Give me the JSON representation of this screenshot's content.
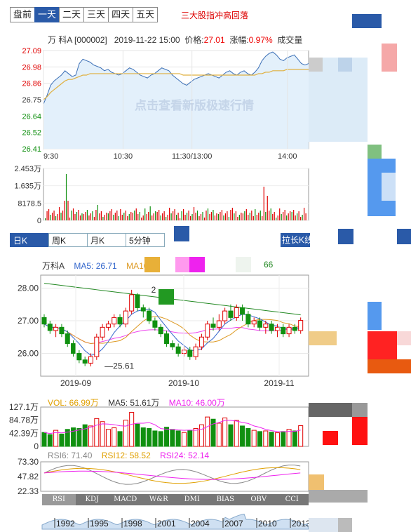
{
  "tabs": [
    "盘前",
    "一天",
    "二天",
    "三天",
    "四天",
    "五天"
  ],
  "active_tab": 1,
  "news": "三大股指冲高回落",
  "info": {
    "name": "万 科A [000002]",
    "datetime": "2019-11-22 15:00",
    "price_label": "价格:",
    "price": "27.01",
    "change_label": "涨幅:",
    "change": "0.97%",
    "volume_label": "成交量"
  },
  "watermark": "点击查看新版极速行情",
  "kline_tabs": [
    "日K",
    "周K",
    "月K",
    "5分钟"
  ],
  "kline_button": "拉长K线",
  "kline_legend": {
    "name": "万科A",
    "ma5": "MA5: 26.71",
    "ma10": "MA10",
    "extra": "66"
  },
  "vol_legend": {
    "vol": "VOL: 66.99万",
    "ma5": "MA5: 51.61万",
    "ma10": "MA10: 46.00万"
  },
  "rsi_legend": {
    "rsi6": "RSI6: 71.40",
    "rsi12": "RSI12: 58.52",
    "rsi24": "RSI24: 52.14"
  },
  "indicator_tabs": [
    "RSI",
    "KDJ",
    "MACD",
    "W&R",
    "DMI",
    "BIAS",
    "OBV",
    "CCI"
  ],
  "timeline_years": [
    "1992",
    "1995",
    "1998",
    "2001",
    "2004",
    "2007",
    "2010",
    "2013"
  ],
  "colors": {
    "up": "#e00000",
    "down": "#109010",
    "blue": "#2a5aa8",
    "ma5": "#3366cc",
    "ma10": "#dd9922",
    "ma20": "#ee44ee",
    "ma60": "#228822"
  },
  "chart_data": [
    {
      "type": "area",
      "name": "intraday",
      "y_ticks": [
        "27.09",
        "26.98",
        "26.86",
        "26.75",
        "26.64",
        "26.52",
        "26.41"
      ],
      "y_tick_colors": [
        "up",
        "up",
        "up",
        "neutral",
        "down",
        "down",
        "down"
      ],
      "x_ticks": [
        "9:30",
        "10:30",
        "11:30/13:00",
        "14:00"
      ],
      "ylim": [
        26.41,
        27.09
      ],
      "price": [
        26.72,
        26.78,
        26.85,
        26.88,
        26.9,
        26.92,
        26.95,
        26.93,
        26.91,
        26.92,
        27.0,
        27.03,
        27.02,
        27.01,
        26.99,
        26.98,
        26.97,
        26.95,
        26.96,
        26.94,
        26.93,
        26.92,
        26.93,
        26.95,
        26.97,
        26.96,
        26.94,
        26.92,
        26.91,
        26.9,
        26.92,
        26.93,
        26.95,
        26.97,
        26.96,
        26.95,
        26.92,
        26.9,
        26.88,
        26.86,
        26.85,
        26.87,
        26.89,
        26.9,
        26.91,
        26.92,
        26.93,
        26.92,
        26.91,
        26.9,
        26.92,
        26.94,
        26.95,
        26.93,
        26.92,
        26.94,
        26.95,
        26.93,
        26.92,
        26.94,
        26.97,
        27.02,
        27.05,
        27.07,
        27.08,
        27.06,
        27.03,
        27.02,
        27.04,
        27.05,
        27.06,
        27.03,
        27.0,
        26.99,
        27.0
      ],
      "avg": [
        26.75,
        26.77,
        26.8,
        26.82,
        26.84,
        26.86,
        26.88,
        26.89,
        26.89,
        26.9,
        26.91,
        26.92,
        26.92,
        26.93,
        26.93,
        26.93,
        26.93,
        26.93,
        26.93,
        26.93,
        26.93,
        26.93,
        26.93,
        26.93,
        26.93,
        26.93,
        26.93,
        26.93,
        26.93,
        26.93,
        26.93,
        26.93,
        26.93,
        26.93,
        26.93,
        26.93,
        26.93,
        26.93,
        26.93,
        26.92,
        26.92,
        26.92,
        26.92,
        26.92,
        26.92,
        26.92,
        26.92,
        26.92,
        26.92,
        26.92,
        26.92,
        26.92,
        26.92,
        26.92,
        26.92,
        26.92,
        26.92,
        26.92,
        26.92,
        26.92,
        26.93,
        26.93,
        26.94,
        26.94,
        26.95,
        26.95,
        26.95,
        26.95,
        26.96,
        26.96,
        26.96,
        26.96,
        26.96,
        26.96,
        26.96
      ]
    },
    {
      "type": "bar",
      "name": "intraday-volume",
      "y_ticks": [
        "2.453万",
        "1.635万",
        "8178.5",
        "0"
      ],
      "ylim": [
        0,
        24530
      ]
    },
    {
      "type": "candlestick",
      "name": "daily-kline",
      "y_ticks": [
        "28.00",
        "27.00",
        "26.00"
      ],
      "x_ticks": [
        "2019-09",
        "2019-10",
        "2019-11"
      ],
      "ylim": [
        25.3,
        28.4
      ],
      "annotations": [
        {
          "text": "25.61",
          "value": 25.61
        },
        {
          "text": "2",
          "value": 27.95
        }
      ],
      "candles": [
        [
          27.1,
          26.9,
          27.2,
          26.8
        ],
        [
          26.9,
          26.7,
          27.0,
          26.6
        ],
        [
          26.7,
          26.8,
          26.9,
          26.5
        ],
        [
          26.8,
          26.6,
          26.9,
          26.5
        ],
        [
          26.6,
          26.3,
          26.7,
          26.2
        ],
        [
          26.3,
          26.0,
          26.4,
          25.9
        ],
        [
          26.0,
          25.8,
          26.1,
          25.7
        ],
        [
          25.8,
          25.7,
          25.9,
          25.61
        ],
        [
          25.7,
          25.9,
          26.0,
          25.6
        ],
        [
          25.9,
          26.5,
          26.6,
          25.8
        ],
        [
          26.5,
          26.8,
          26.9,
          26.4
        ],
        [
          26.8,
          26.9,
          27.0,
          26.7
        ],
        [
          26.9,
          27.1,
          27.2,
          26.8
        ],
        [
          27.1,
          26.9,
          27.2,
          26.8
        ],
        [
          26.9,
          27.3,
          27.4,
          26.8
        ],
        [
          27.3,
          27.8,
          27.95,
          27.2
        ],
        [
          27.8,
          27.4,
          27.85,
          27.3
        ],
        [
          27.4,
          27.3,
          27.5,
          27.1
        ],
        [
          27.3,
          27.0,
          27.4,
          26.9
        ],
        [
          27.0,
          26.8,
          27.1,
          26.7
        ],
        [
          26.8,
          26.6,
          26.9,
          26.5
        ],
        [
          26.6,
          26.3,
          26.7,
          26.2
        ],
        [
          26.3,
          26.2,
          26.4,
          26.1
        ],
        [
          26.2,
          26.0,
          26.3,
          25.9
        ],
        [
          26.0,
          26.1,
          26.2,
          25.9
        ],
        [
          26.1,
          25.9,
          26.2,
          25.8
        ],
        [
          25.9,
          26.2,
          26.3,
          25.8
        ],
        [
          26.2,
          26.5,
          26.6,
          26.1
        ],
        [
          26.5,
          26.9,
          27.0,
          26.4
        ],
        [
          26.9,
          26.8,
          27.1,
          26.7
        ],
        [
          26.8,
          27.0,
          27.2,
          26.7
        ],
        [
          27.0,
          27.3,
          27.4,
          26.9
        ],
        [
          27.3,
          27.1,
          27.5,
          27.0
        ],
        [
          27.1,
          27.4,
          27.5,
          27.0
        ],
        [
          27.4,
          27.2,
          27.5,
          27.0
        ],
        [
          27.2,
          26.9,
          27.3,
          26.8
        ],
        [
          26.9,
          27.0,
          27.1,
          26.8
        ],
        [
          27.0,
          26.8,
          27.1,
          26.7
        ],
        [
          26.8,
          26.9,
          27.0,
          26.6
        ],
        [
          26.9,
          26.7,
          27.0,
          26.6
        ],
        [
          26.7,
          26.8,
          26.9,
          26.5
        ],
        [
          26.8,
          26.6,
          26.9,
          26.5
        ],
        [
          26.6,
          26.8,
          26.9,
          26.5
        ],
        [
          26.8,
          26.7,
          26.9,
          26.6
        ],
        [
          26.7,
          27.01,
          27.1,
          26.6
        ]
      ]
    },
    {
      "type": "bar",
      "name": "daily-volume",
      "y_ticks": [
        "127.1万",
        "84.78万",
        "42.39万",
        "0"
      ],
      "ylim": [
        0,
        127.1
      ],
      "values": [
        45,
        38,
        52,
        40,
        55,
        60,
        58,
        70,
        66,
        90,
        80,
        55,
        60,
        48,
        85,
        110,
        72,
        60,
        58,
        50,
        48,
        62,
        55,
        50,
        45,
        52,
        58,
        70,
        95,
        88,
        75,
        92,
        70,
        84,
        66,
        58,
        52,
        48,
        50,
        46,
        44,
        48,
        55,
        50,
        67
      ]
    },
    {
      "type": "line",
      "name": "rsi",
      "y_ticks": [
        "73.30",
        "47.82",
        "22.33"
      ],
      "ylim": [
        22.33,
        73.3
      ]
    }
  ]
}
